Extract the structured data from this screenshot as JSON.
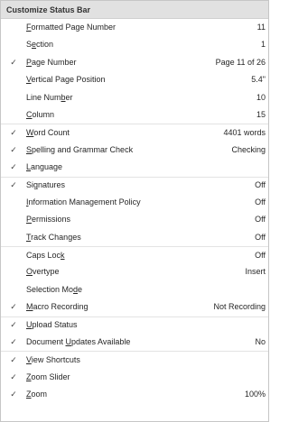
{
  "menu": {
    "title": "Customize Status Bar",
    "check_glyph": "✓",
    "items": [
      {
        "pre": "",
        "key": "F",
        "post": "ormatted Page Number",
        "value": "11",
        "checked": false,
        "sep": false
      },
      {
        "pre": "S",
        "key": "e",
        "post": "ction",
        "value": "1",
        "checked": false,
        "sep": false
      },
      {
        "pre": "",
        "key": "P",
        "post": "age Number",
        "value": "Page 11 of 26",
        "checked": true,
        "sep": false
      },
      {
        "pre": "",
        "key": "V",
        "post": "ertical Page Position",
        "value": "5.4\"",
        "checked": false,
        "sep": false
      },
      {
        "pre": "Line Num",
        "key": "b",
        "post": "er",
        "value": "10",
        "checked": false,
        "sep": false
      },
      {
        "pre": "",
        "key": "C",
        "post": "olumn",
        "value": "15",
        "checked": false,
        "sep": false
      },
      {
        "pre": "",
        "key": "W",
        "post": "ord Count",
        "value": "4401 words",
        "checked": true,
        "sep": true
      },
      {
        "pre": "",
        "key": "S",
        "post": "pelling and Grammar Check",
        "value": "Checking",
        "checked": true,
        "sep": false
      },
      {
        "pre": "",
        "key": "L",
        "post": "anguage",
        "value": "",
        "checked": true,
        "sep": false
      },
      {
        "pre": "Si",
        "key": "g",
        "post": "natures",
        "value": "Off",
        "checked": true,
        "sep": true
      },
      {
        "pre": "",
        "key": "I",
        "post": "nformation Management Policy",
        "value": "Off",
        "checked": false,
        "sep": false
      },
      {
        "pre": "",
        "key": "P",
        "post": "ermissions",
        "value": "Off",
        "checked": false,
        "sep": false
      },
      {
        "pre": "",
        "key": "T",
        "post": "rack Changes",
        "value": "Off",
        "checked": false,
        "sep": false
      },
      {
        "pre": "Caps Loc",
        "key": "k",
        "post": "",
        "value": "Off",
        "checked": false,
        "sep": true
      },
      {
        "pre": "",
        "key": "O",
        "post": "vertype",
        "value": "Insert",
        "checked": false,
        "sep": false
      },
      {
        "pre": "Selection Mo",
        "key": "d",
        "post": "e",
        "value": "",
        "checked": false,
        "sep": false
      },
      {
        "pre": "",
        "key": "M",
        "post": "acro Recording",
        "value": "Not Recording",
        "checked": true,
        "sep": false
      },
      {
        "pre": "",
        "key": "U",
        "post": "pload Status",
        "value": "",
        "checked": true,
        "sep": true
      },
      {
        "pre": "Document ",
        "key": "U",
        "post": "pdates Available",
        "value": "No",
        "checked": true,
        "sep": false
      },
      {
        "pre": "",
        "key": "V",
        "post": "iew Shortcuts",
        "value": "",
        "checked": true,
        "sep": true
      },
      {
        "pre": "",
        "key": "Z",
        "post": "oom Slider",
        "value": "",
        "checked": true,
        "sep": false
      },
      {
        "pre": "",
        "key": "Z",
        "post": "oom",
        "value": "100%",
        "checked": true,
        "sep": false
      }
    ]
  }
}
